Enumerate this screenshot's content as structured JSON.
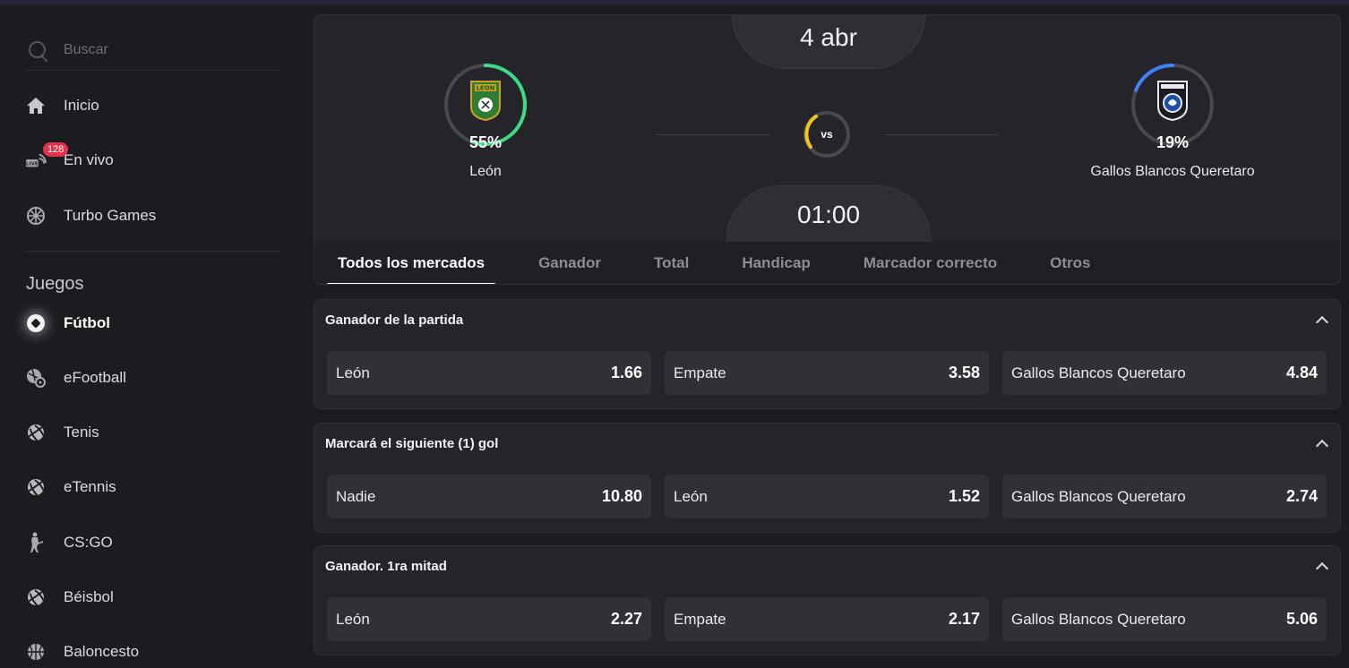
{
  "search": {
    "placeholder": "Buscar"
  },
  "nav": {
    "top": [
      {
        "label": "Inicio",
        "icon": "home-icon"
      },
      {
        "label": "En vivo",
        "icon": "live-icon",
        "badge": "128"
      },
      {
        "label": "Turbo Games",
        "icon": "turbo-icon"
      }
    ],
    "section_title": "Juegos",
    "games": [
      {
        "label": "Fútbol",
        "icon": "soccer-ball-icon",
        "active": true
      },
      {
        "label": "eFootball",
        "icon": "efootball-icon"
      },
      {
        "label": "Tenis",
        "icon": "tennis-ball-icon"
      },
      {
        "label": "eTennis",
        "icon": "etennis-icon"
      },
      {
        "label": "CS:GO",
        "icon": "csgo-soldier-icon"
      },
      {
        "label": "Béisbol",
        "icon": "baseball-icon"
      },
      {
        "label": "Baloncesto",
        "icon": "basketball-icon"
      }
    ]
  },
  "match": {
    "date": "4 abr",
    "time": "01:00",
    "vs": "vs",
    "home": {
      "name": "León",
      "pct": "55%",
      "win_fraction": 0.55,
      "ring_color": "#3ddc84"
    },
    "away": {
      "name": "Gallos Blancos Queretaro",
      "pct": "19%",
      "win_fraction": 0.19,
      "ring_color": "#3b82f6"
    },
    "draw_ring_color": "#f5c518"
  },
  "tabs": [
    "Todos los mercados",
    "Ganador",
    "Total",
    "Handicap",
    "Marcador correcto",
    "Otros"
  ],
  "markets": [
    {
      "title": "Ganador de la partida",
      "odds": [
        {
          "label": "León",
          "value": "1.66"
        },
        {
          "label": "Empate",
          "value": "3.58"
        },
        {
          "label": "Gallos Blancos Queretaro",
          "value": "4.84"
        }
      ]
    },
    {
      "title": "Marcará el siguiente (1) gol",
      "odds": [
        {
          "label": "Nadie",
          "value": "10.80"
        },
        {
          "label": "León",
          "value": "1.52"
        },
        {
          "label": "Gallos Blancos Queretaro",
          "value": "2.74"
        }
      ]
    },
    {
      "title": "Ganador. 1ra mitad",
      "odds": [
        {
          "label": "León",
          "value": "2.27"
        },
        {
          "label": "Empate",
          "value": "2.17"
        },
        {
          "label": "Gallos Blancos Queretaro",
          "value": "5.06"
        }
      ]
    }
  ]
}
